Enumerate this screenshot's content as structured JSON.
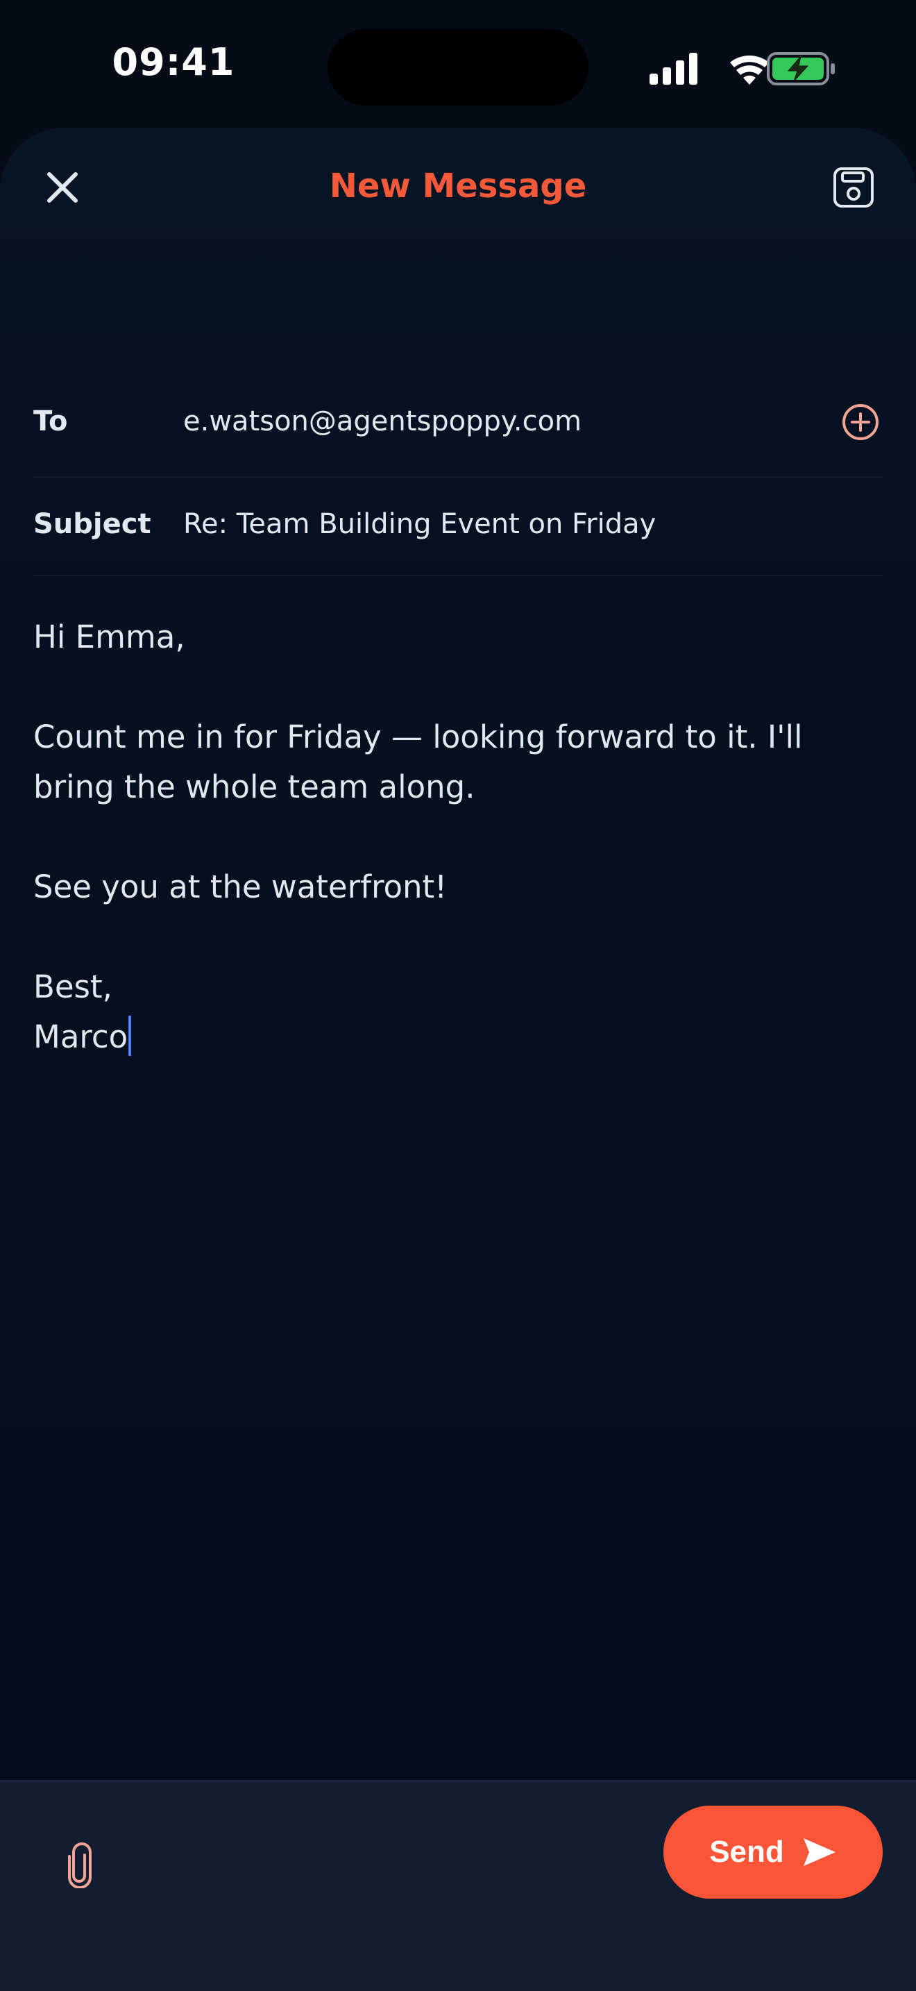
{
  "status_bar": {
    "time": "09:41"
  },
  "compose": {
    "title": "New Message",
    "to_label": "To",
    "to_value": "e.watson@agentspoppy.com",
    "subject_label": "Subject",
    "subject_value": "Re: Team Building Event on Friday",
    "body": {
      "greeting": "Hi Emma,",
      "paragraph": "Count me in for Friday — looking forward to it. I'll bring the whole team along.",
      "closing_line": "See you at the waterfront!",
      "signoff": "Best,",
      "signature": "Marco"
    },
    "send_label": "Send"
  },
  "icons": {
    "close": "close-icon",
    "save": "save-draft-icon",
    "add_recipient": "plus-circle-icon",
    "attach": "paperclip-icon",
    "send": "send-arrow-icon"
  },
  "colors": {
    "accent": "#fb5436",
    "title": "#f4593a",
    "background": "#050c18",
    "toolbar": "#121e2f",
    "cursor": "#4f7dff",
    "battery": "#34c759"
  }
}
